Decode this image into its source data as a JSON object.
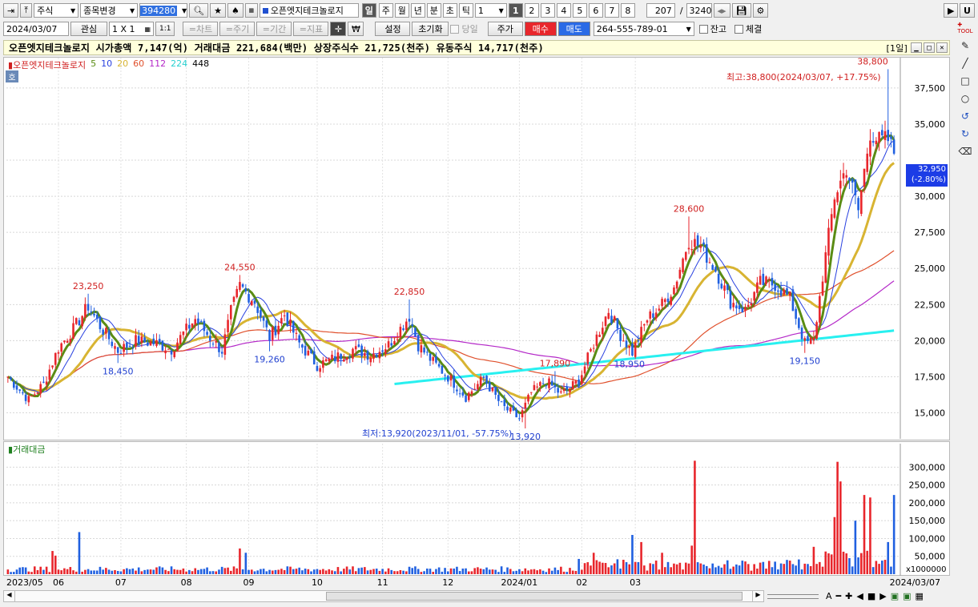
{
  "toolbar1": {
    "market_select": "주식",
    "change_button": "종목변경",
    "code_input": "394280",
    "stock_name": "오픈엣지테크놀로지",
    "periods": [
      "일",
      "주",
      "월",
      "년",
      "분",
      "초",
      "틱"
    ],
    "active_period": "일",
    "interval_value": "1",
    "number_buttons": [
      "1",
      "2",
      "3",
      "4",
      "5",
      "6",
      "7",
      "8"
    ],
    "active_number": "1",
    "count_current": "207",
    "count_separator": "/",
    "count_total": "3240",
    "right_button": "U"
  },
  "toolbar2": {
    "date": "2024/03/07",
    "watch_button": "관심",
    "layout_label": "1 X 1",
    "layout_btn2": "1:1",
    "chart_btn": "=차트",
    "period_btn": "=주기",
    "range_btn": "=기간",
    "indicator_btn": "=지표",
    "crosshair_icon": "✛",
    "won_icon": "₩",
    "settings_btn": "설정",
    "reset_btn": "초기화",
    "today_label": "당일",
    "price_btn": "주가",
    "buy_btn": "매수",
    "sell_btn": "매도",
    "account_value": "264-555-789-01",
    "balance_label": "잔고",
    "execution_label": "체결"
  },
  "infobar": {
    "text": "오픈엣지테크놀로지  시가총액 7,147(억)  거래대금 221,684(백만)  상장주식수 21,725(천주)  유동주식 14,717(천주)",
    "window_label": "[1일]"
  },
  "legend": {
    "name": "오픈엣지테크놀로지",
    "ma_periods": [
      "5",
      "10",
      "20",
      "60",
      "112",
      "224",
      "448"
    ],
    "ma_colors": [
      "#5a8c14",
      "#2840e0",
      "#d8b432",
      "#e0502c",
      "#b428c8",
      "#28f0f0",
      "#000000"
    ],
    "hoga_label": "호"
  },
  "volume_legend": "거래대금",
  "colors": {
    "up": "#e8262c",
    "down": "#2060e0",
    "current_price_bg": "#1c3ce6",
    "axis_text": "#000000"
  },
  "chart_data": {
    "type": "candlestick",
    "title": "",
    "y_ticks": [
      15000,
      17500,
      20000,
      22500,
      25000,
      27500,
      30000,
      32500,
      35000,
      37500
    ],
    "y_tick_labels": [
      "15,000",
      "17,500",
      "20,000",
      "22,500",
      "25,000",
      "27,500",
      "30,000",
      "",
      "35,000",
      "37,500"
    ],
    "ylim": [
      13200,
      39600
    ],
    "x_labels": [
      "2023/05",
      "06",
      "07",
      "08",
      "09",
      "10",
      "11",
      "12",
      "2024/01",
      "02",
      "03"
    ],
    "x_end_label": "2024/03/07",
    "current_price": "32,950",
    "current_change": "(-2.80%)",
    "high_annotation": "최고:38,800(2024/03/07, +17.75%)",
    "low_annotation": "최저:13,920(2023/11/01, -57.75%)",
    "peak_labels": [
      {
        "date_index": 27,
        "price": 23250,
        "text": "23,250",
        "kind": "high"
      },
      {
        "date_index": 37,
        "price": 18450,
        "text": "18,450",
        "kind": "low"
      },
      {
        "date_index": 78,
        "price": 24550,
        "text": "24,550",
        "kind": "high"
      },
      {
        "date_index": 88,
        "price": 19260,
        "text": "19,260",
        "kind": "low"
      },
      {
        "date_index": 135,
        "price": 22850,
        "text": "22,850",
        "kind": "high"
      },
      {
        "date_index": 174,
        "price": 13920,
        "text": "13,920",
        "kind": "low"
      },
      {
        "date_index": 184,
        "price": 17890,
        "text": "17,890",
        "kind": "high"
      },
      {
        "date_index": 209,
        "price": 18950,
        "text": "18,950",
        "kind": "low"
      },
      {
        "date_index": 229,
        "price": 28600,
        "text": "28,600",
        "kind": "high"
      },
      {
        "date_index": 268,
        "price": 19150,
        "text": "19,150",
        "kind": "low"
      },
      {
        "date_index": 296,
        "price": 38800,
        "text": "38,800",
        "kind": "high"
      }
    ],
    "price_anchors": [
      [
        0,
        17500
      ],
      [
        3,
        16800
      ],
      [
        7,
        15900
      ],
      [
        12,
        17000
      ],
      [
        17,
        19500
      ],
      [
        22,
        20800
      ],
      [
        27,
        22400
      ],
      [
        31,
        21000
      ],
      [
        37,
        19300
      ],
      [
        43,
        20000
      ],
      [
        50,
        19800
      ],
      [
        55,
        19400
      ],
      [
        59,
        20500
      ],
      [
        63,
        21500
      ],
      [
        68,
        20200
      ],
      [
        72,
        19300
      ],
      [
        75,
        22000
      ],
      [
        78,
        23800
      ],
      [
        83,
        22700
      ],
      [
        88,
        20200
      ],
      [
        93,
        21800
      ],
      [
        98,
        19800
      ],
      [
        104,
        18300
      ],
      [
        110,
        18800
      ],
      [
        116,
        19400
      ],
      [
        122,
        19000
      ],
      [
        128,
        19700
      ],
      [
        135,
        21700
      ],
      [
        138,
        19700
      ],
      [
        143,
        18500
      ],
      [
        149,
        17300
      ],
      [
        154,
        16100
      ],
      [
        160,
        17400
      ],
      [
        166,
        15500
      ],
      [
        172,
        14600
      ],
      [
        176,
        16400
      ],
      [
        181,
        17200
      ],
      [
        186,
        16300
      ],
      [
        192,
        17200
      ],
      [
        197,
        19800
      ],
      [
        202,
        22100
      ],
      [
        206,
        20400
      ],
      [
        210,
        19200
      ],
      [
        215,
        21500
      ],
      [
        220,
        22500
      ],
      [
        224,
        23700
      ],
      [
        229,
        27000
      ],
      [
        233,
        26500
      ],
      [
        238,
        24900
      ],
      [
        243,
        22700
      ],
      [
        248,
        22100
      ],
      [
        253,
        24000
      ],
      [
        258,
        23900
      ],
      [
        263,
        22900
      ],
      [
        268,
        19800
      ],
      [
        271,
        20000
      ],
      [
        274,
        24500
      ],
      [
        278,
        30000
      ],
      [
        282,
        32000
      ],
      [
        286,
        29000
      ],
      [
        290,
        34500
      ],
      [
        293,
        33800
      ],
      [
        296,
        33900
      ],
      [
        298,
        32950
      ]
    ],
    "volume_unit": "x1000000",
    "volume_ticks": [
      50000,
      100000,
      150000,
      200000,
      250000,
      300000
    ],
    "volume_tick_labels": [
      "50,000",
      "100,000",
      "150,000",
      "200,000",
      "250,000",
      "300,000"
    ],
    "volume_max": 330000,
    "volume_spikes": [
      [
        15,
        65000
      ],
      [
        16,
        52000
      ],
      [
        24,
        118000
      ],
      [
        78,
        72000
      ],
      [
        80,
        60000
      ],
      [
        231,
        318000
      ],
      [
        230,
        80000
      ],
      [
        220,
        60000
      ],
      [
        197,
        60000
      ],
      [
        210,
        110000
      ],
      [
        213,
        90000
      ],
      [
        278,
        160000
      ],
      [
        279,
        315000
      ],
      [
        280,
        260000
      ],
      [
        285,
        150000
      ],
      [
        288,
        222000
      ],
      [
        290,
        215000
      ],
      [
        296,
        90000
      ],
      [
        298,
        222000
      ]
    ]
  }
}
